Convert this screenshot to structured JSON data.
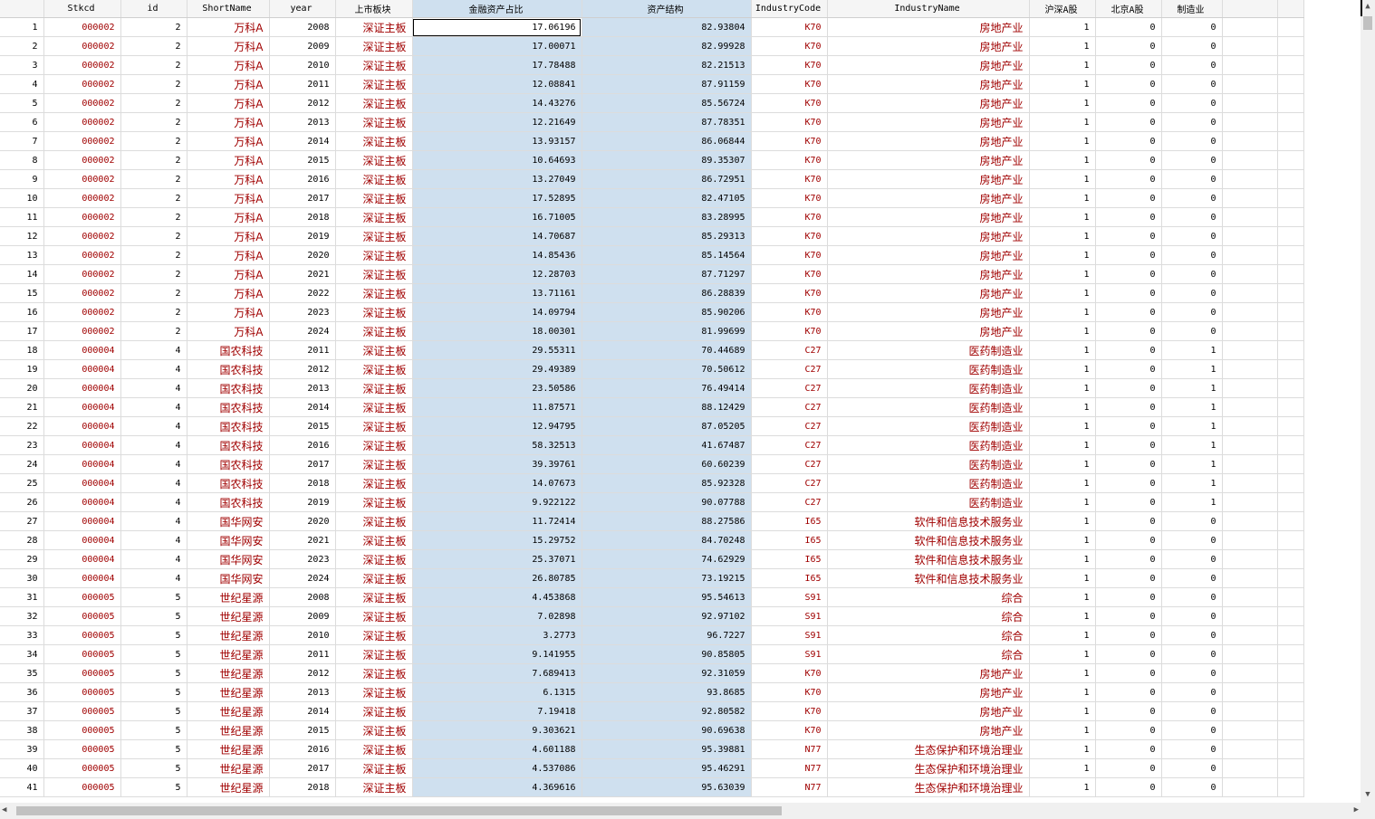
{
  "headers": [
    "",
    "Stkcd",
    "id",
    "ShortName",
    "year",
    "上市板块",
    "金融资产占比",
    "资产结构",
    "IndustryCode",
    "IndustryName",
    "沪深A股",
    "北京A股",
    "制造业",
    "",
    ""
  ],
  "rows": [
    [
      "1",
      "000002",
      "2",
      "万科A",
      "2008",
      "深证主板",
      "17.06196",
      "82.93804",
      "K70",
      "房地产业",
      "1",
      "0",
      "0"
    ],
    [
      "2",
      "000002",
      "2",
      "万科A",
      "2009",
      "深证主板",
      "17.00071",
      "82.99928",
      "K70",
      "房地产业",
      "1",
      "0",
      "0"
    ],
    [
      "3",
      "000002",
      "2",
      "万科A",
      "2010",
      "深证主板",
      "17.78488",
      "82.21513",
      "K70",
      "房地产业",
      "1",
      "0",
      "0"
    ],
    [
      "4",
      "000002",
      "2",
      "万科A",
      "2011",
      "深证主板",
      "12.08841",
      "87.91159",
      "K70",
      "房地产业",
      "1",
      "0",
      "0"
    ],
    [
      "5",
      "000002",
      "2",
      "万科A",
      "2012",
      "深证主板",
      "14.43276",
      "85.56724",
      "K70",
      "房地产业",
      "1",
      "0",
      "0"
    ],
    [
      "6",
      "000002",
      "2",
      "万科A",
      "2013",
      "深证主板",
      "12.21649",
      "87.78351",
      "K70",
      "房地产业",
      "1",
      "0",
      "0"
    ],
    [
      "7",
      "000002",
      "2",
      "万科A",
      "2014",
      "深证主板",
      "13.93157",
      "86.06844",
      "K70",
      "房地产业",
      "1",
      "0",
      "0"
    ],
    [
      "8",
      "000002",
      "2",
      "万科A",
      "2015",
      "深证主板",
      "10.64693",
      "89.35307",
      "K70",
      "房地产业",
      "1",
      "0",
      "0"
    ],
    [
      "9",
      "000002",
      "2",
      "万科A",
      "2016",
      "深证主板",
      "13.27049",
      "86.72951",
      "K70",
      "房地产业",
      "1",
      "0",
      "0"
    ],
    [
      "10",
      "000002",
      "2",
      "万科A",
      "2017",
      "深证主板",
      "17.52895",
      "82.47105",
      "K70",
      "房地产业",
      "1",
      "0",
      "0"
    ],
    [
      "11",
      "000002",
      "2",
      "万科A",
      "2018",
      "深证主板",
      "16.71005",
      "83.28995",
      "K70",
      "房地产业",
      "1",
      "0",
      "0"
    ],
    [
      "12",
      "000002",
      "2",
      "万科A",
      "2019",
      "深证主板",
      "14.70687",
      "85.29313",
      "K70",
      "房地产业",
      "1",
      "0",
      "0"
    ],
    [
      "13",
      "000002",
      "2",
      "万科A",
      "2020",
      "深证主板",
      "14.85436",
      "85.14564",
      "K70",
      "房地产业",
      "1",
      "0",
      "0"
    ],
    [
      "14",
      "000002",
      "2",
      "万科A",
      "2021",
      "深证主板",
      "12.28703",
      "87.71297",
      "K70",
      "房地产业",
      "1",
      "0",
      "0"
    ],
    [
      "15",
      "000002",
      "2",
      "万科A",
      "2022",
      "深证主板",
      "13.71161",
      "86.28839",
      "K70",
      "房地产业",
      "1",
      "0",
      "0"
    ],
    [
      "16",
      "000002",
      "2",
      "万科A",
      "2023",
      "深证主板",
      "14.09794",
      "85.90206",
      "K70",
      "房地产业",
      "1",
      "0",
      "0"
    ],
    [
      "17",
      "000002",
      "2",
      "万科A",
      "2024",
      "深证主板",
      "18.00301",
      "81.99699",
      "K70",
      "房地产业",
      "1",
      "0",
      "0"
    ],
    [
      "18",
      "000004",
      "4",
      "国农科技",
      "2011",
      "深证主板",
      "29.55311",
      "70.44689",
      "C27",
      "医药制造业",
      "1",
      "0",
      "1"
    ],
    [
      "19",
      "000004",
      "4",
      "国农科技",
      "2012",
      "深证主板",
      "29.49389",
      "70.50612",
      "C27",
      "医药制造业",
      "1",
      "0",
      "1"
    ],
    [
      "20",
      "000004",
      "4",
      "国农科技",
      "2013",
      "深证主板",
      "23.50586",
      "76.49414",
      "C27",
      "医药制造业",
      "1",
      "0",
      "1"
    ],
    [
      "21",
      "000004",
      "4",
      "国农科技",
      "2014",
      "深证主板",
      "11.87571",
      "88.12429",
      "C27",
      "医药制造业",
      "1",
      "0",
      "1"
    ],
    [
      "22",
      "000004",
      "4",
      "国农科技",
      "2015",
      "深证主板",
      "12.94795",
      "87.05205",
      "C27",
      "医药制造业",
      "1",
      "0",
      "1"
    ],
    [
      "23",
      "000004",
      "4",
      "国农科技",
      "2016",
      "深证主板",
      "58.32513",
      "41.67487",
      "C27",
      "医药制造业",
      "1",
      "0",
      "1"
    ],
    [
      "24",
      "000004",
      "4",
      "国农科技",
      "2017",
      "深证主板",
      "39.39761",
      "60.60239",
      "C27",
      "医药制造业",
      "1",
      "0",
      "1"
    ],
    [
      "25",
      "000004",
      "4",
      "国农科技",
      "2018",
      "深证主板",
      "14.07673",
      "85.92328",
      "C27",
      "医药制造业",
      "1",
      "0",
      "1"
    ],
    [
      "26",
      "000004",
      "4",
      "国农科技",
      "2019",
      "深证主板",
      "9.922122",
      "90.07788",
      "C27",
      "医药制造业",
      "1",
      "0",
      "1"
    ],
    [
      "27",
      "000004",
      "4",
      "国华网安",
      "2020",
      "深证主板",
      "11.72414",
      "88.27586",
      "I65",
      "软件和信息技术服务业",
      "1",
      "0",
      "0"
    ],
    [
      "28",
      "000004",
      "4",
      "国华网安",
      "2021",
      "深证主板",
      "15.29752",
      "84.70248",
      "I65",
      "软件和信息技术服务业",
      "1",
      "0",
      "0"
    ],
    [
      "29",
      "000004",
      "4",
      "国华网安",
      "2023",
      "深证主板",
      "25.37071",
      "74.62929",
      "I65",
      "软件和信息技术服务业",
      "1",
      "0",
      "0"
    ],
    [
      "30",
      "000004",
      "4",
      "国华网安",
      "2024",
      "深证主板",
      "26.80785",
      "73.19215",
      "I65",
      "软件和信息技术服务业",
      "1",
      "0",
      "0"
    ],
    [
      "31",
      "000005",
      "5",
      "世纪星源",
      "2008",
      "深证主板",
      "4.453868",
      "95.54613",
      "S91",
      "综合",
      "1",
      "0",
      "0"
    ],
    [
      "32",
      "000005",
      "5",
      "世纪星源",
      "2009",
      "深证主板",
      "7.02898",
      "92.97102",
      "S91",
      "综合",
      "1",
      "0",
      "0"
    ],
    [
      "33",
      "000005",
      "5",
      "世纪星源",
      "2010",
      "深证主板",
      "3.2773",
      "96.7227",
      "S91",
      "综合",
      "1",
      "0",
      "0"
    ],
    [
      "34",
      "000005",
      "5",
      "世纪星源",
      "2011",
      "深证主板",
      "9.141955",
      "90.85805",
      "S91",
      "综合",
      "1",
      "0",
      "0"
    ],
    [
      "35",
      "000005",
      "5",
      "世纪星源",
      "2012",
      "深证主板",
      "7.689413",
      "92.31059",
      "K70",
      "房地产业",
      "1",
      "0",
      "0"
    ],
    [
      "36",
      "000005",
      "5",
      "世纪星源",
      "2013",
      "深证主板",
      "6.1315",
      "93.8685",
      "K70",
      "房地产业",
      "1",
      "0",
      "0"
    ],
    [
      "37",
      "000005",
      "5",
      "世纪星源",
      "2014",
      "深证主板",
      "7.19418",
      "92.80582",
      "K70",
      "房地产业",
      "1",
      "0",
      "0"
    ],
    [
      "38",
      "000005",
      "5",
      "世纪星源",
      "2015",
      "深证主板",
      "9.303621",
      "90.69638",
      "K70",
      "房地产业",
      "1",
      "0",
      "0"
    ],
    [
      "39",
      "000005",
      "5",
      "世纪星源",
      "2016",
      "深证主板",
      "4.601188",
      "95.39881",
      "N77",
      "生态保护和环境治理业",
      "1",
      "0",
      "0"
    ],
    [
      "40",
      "000005",
      "5",
      "世纪星源",
      "2017",
      "深证主板",
      "4.537086",
      "95.46291",
      "N77",
      "生态保护和环境治理业",
      "1",
      "0",
      "0"
    ],
    [
      "41",
      "000005",
      "5",
      "世纪星源",
      "2018",
      "深证主板",
      "4.369616",
      "95.63039",
      "N77",
      "生态保护和环境治理业",
      "1",
      "0",
      "0"
    ]
  ],
  "colors": {
    "selected_column_bg": "#cfe0ef",
    "string_text": "#a00000",
    "grid_line": "#dcdcdc"
  },
  "icons": {
    "scroll_up": "triangle-up",
    "scroll_down": "triangle-down",
    "scroll_left": "triangle-left",
    "scroll_right": "triangle-right"
  }
}
